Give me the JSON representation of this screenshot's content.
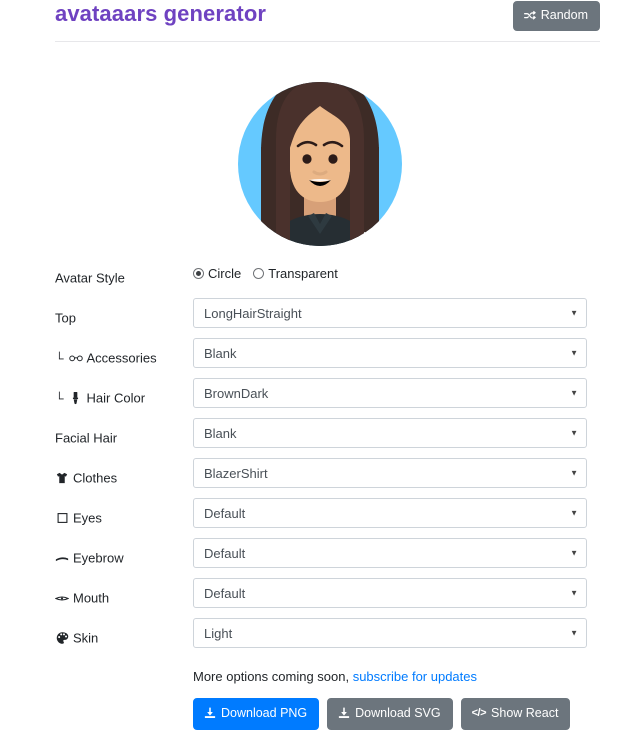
{
  "header": {
    "title": "avataaars generator",
    "random_button": {
      "label": "Random",
      "icon": "shuffle-icon"
    }
  },
  "avatar": {
    "style": "Circle",
    "background_color": "#65C9FF",
    "hair_color": "#4A312C",
    "skin_color": "#EDB98A",
    "clothes_color": "#262E33",
    "eye_color": "#2C1B18",
    "mouth_color": "#000000",
    "description": "LongHairStraight avatar with light skin, BrownDark hair, BlazerShirt, default eyes, eyebrows and smiling mouth on a circle background"
  },
  "form": {
    "avatar_style": {
      "label": "Avatar Style",
      "options": [
        "Circle",
        "Transparent"
      ],
      "selected": "Circle"
    },
    "fields": [
      {
        "label": "Top",
        "icon": null,
        "sub": false,
        "value": "LongHairStraight"
      },
      {
        "label": "Accessories",
        "icon": "glasses-icon",
        "sub": true,
        "value": "Blank"
      },
      {
        "label": "Hair Color",
        "icon": "paint-brush-icon",
        "sub": true,
        "value": "BrownDark"
      },
      {
        "label": "Facial Hair",
        "icon": null,
        "sub": false,
        "value": "Blank"
      },
      {
        "label": "Clothes",
        "icon": "tshirt-icon",
        "sub": false,
        "value": "BlazerShirt"
      },
      {
        "label": "Eyes",
        "icon": "eye-icon",
        "sub": false,
        "value": "Default"
      },
      {
        "label": "Eyebrow",
        "icon": "eyebrow-icon",
        "sub": false,
        "value": "Default"
      },
      {
        "label": "Mouth",
        "icon": "mouth-icon",
        "sub": false,
        "value": "Default"
      },
      {
        "label": "Skin",
        "icon": "palette-icon",
        "sub": false,
        "value": "Light"
      }
    ]
  },
  "footer": {
    "more_text_prefix": "More options coming soon, ",
    "subscribe_link": "subscribe for updates",
    "buttons": [
      {
        "label": "Download PNG",
        "icon": "download-icon",
        "style": "primary"
      },
      {
        "label": "Download SVG",
        "icon": "download-icon",
        "style": "secondary"
      },
      {
        "label": "Show React",
        "icon": "code-icon",
        "style": "secondary"
      }
    ]
  },
  "colors": {
    "title": "#6f42c1",
    "primary": "#007bff",
    "secondary": "#6c757d",
    "link": "#007bff"
  }
}
